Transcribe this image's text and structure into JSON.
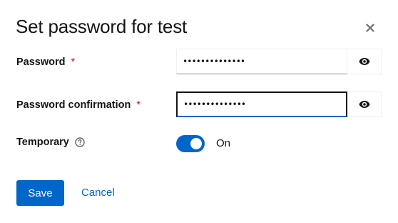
{
  "dialog": {
    "title": "Set password for test",
    "close_icon": "close-icon"
  },
  "password": {
    "label": "Password",
    "required_mark": "*",
    "value": "••••••••••••••",
    "toggle_icon": "eye-icon"
  },
  "confirmation": {
    "label": "Password confirmation",
    "required_mark": "*",
    "value": "••••••••••••••",
    "toggle_icon": "eye-icon"
  },
  "temporary": {
    "label": "Temporary",
    "help_icon": "help-icon",
    "state": "On",
    "checked": true
  },
  "actions": {
    "save_label": "Save",
    "cancel_label": "Cancel"
  },
  "colors": {
    "primary": "#0066cc",
    "required": "#c9190b",
    "text": "#151515"
  }
}
